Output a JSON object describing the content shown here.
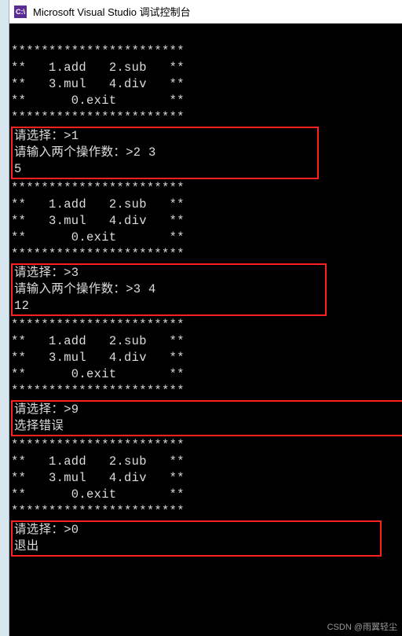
{
  "window": {
    "icon_label": "C:\\",
    "title": "Microsoft Visual Studio 调试控制台"
  },
  "menu": {
    "border": "***********************",
    "row1": "**   1.add   2.sub   **",
    "row2": "**   3.mul   4.div   **",
    "row3": "**      0.exit       **"
  },
  "sessions": [
    {
      "prompt_choice": "请选择：>1",
      "prompt_operands": "请输入两个操作数：>2 3",
      "result": "5",
      "width_hint": "                                       "
    },
    {
      "prompt_choice": "请选择：>3",
      "prompt_operands": "请输入两个操作数：>3 4",
      "result": "12",
      "width_hint": "                                       "
    },
    {
      "prompt_choice": "请选择：>9",
      "error": "选择错误",
      "width_hint": "                                             "
    },
    {
      "prompt_choice": "请选择：>0",
      "exit": "退出",
      "width_hint": "                                             "
    }
  ],
  "watermark": "CSDN @雨翼轻尘"
}
